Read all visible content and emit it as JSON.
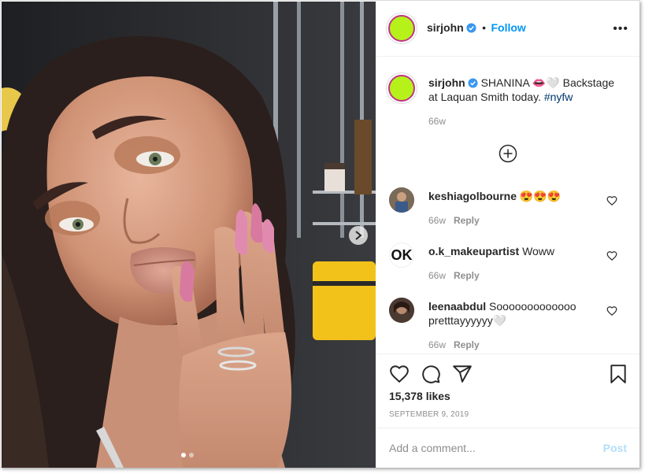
{
  "post": {
    "username": "sirjohn",
    "separator": "•",
    "follow_label": "Follow",
    "more_label": "•••",
    "caption": {
      "username": "sirjohn",
      "text": "SHANINA 👄🤍 Backstage at Laquan Smith today.",
      "hashtag": "#nyfw",
      "age": "66w"
    },
    "comments": [
      {
        "username": "keshiagolbourne",
        "text": "😍😍😍",
        "age": "66w",
        "reply_label": "Reply"
      },
      {
        "username": "o.k_makeupartist",
        "text": "Woww",
        "age": "66w",
        "reply_label": "Reply",
        "avatar_text": "OK"
      },
      {
        "username": "leenaabdul",
        "text": "Sooooooooooooo pretttayyyyyy🤍",
        "age": "66w",
        "reply_label": "Reply"
      }
    ],
    "likes": "15,378 likes",
    "date": "SEPTEMBER 9, 2019",
    "comment_input": {
      "placeholder": "Add a comment...",
      "value": ""
    },
    "post_button": "Post",
    "carousel": {
      "current": 1,
      "total": 2
    }
  },
  "colors": {
    "accent": "#0095f6",
    "avatar_fill": "#b6f21a",
    "avatar_ring": "#c13584",
    "text": "#262626",
    "muted": "#8e8e8e"
  },
  "icons": [
    "verified-badge-icon",
    "more-options-icon",
    "load-more-plus-icon",
    "heart-icon",
    "comment-icon",
    "share-icon",
    "bookmark-icon",
    "carousel-next-icon"
  ]
}
